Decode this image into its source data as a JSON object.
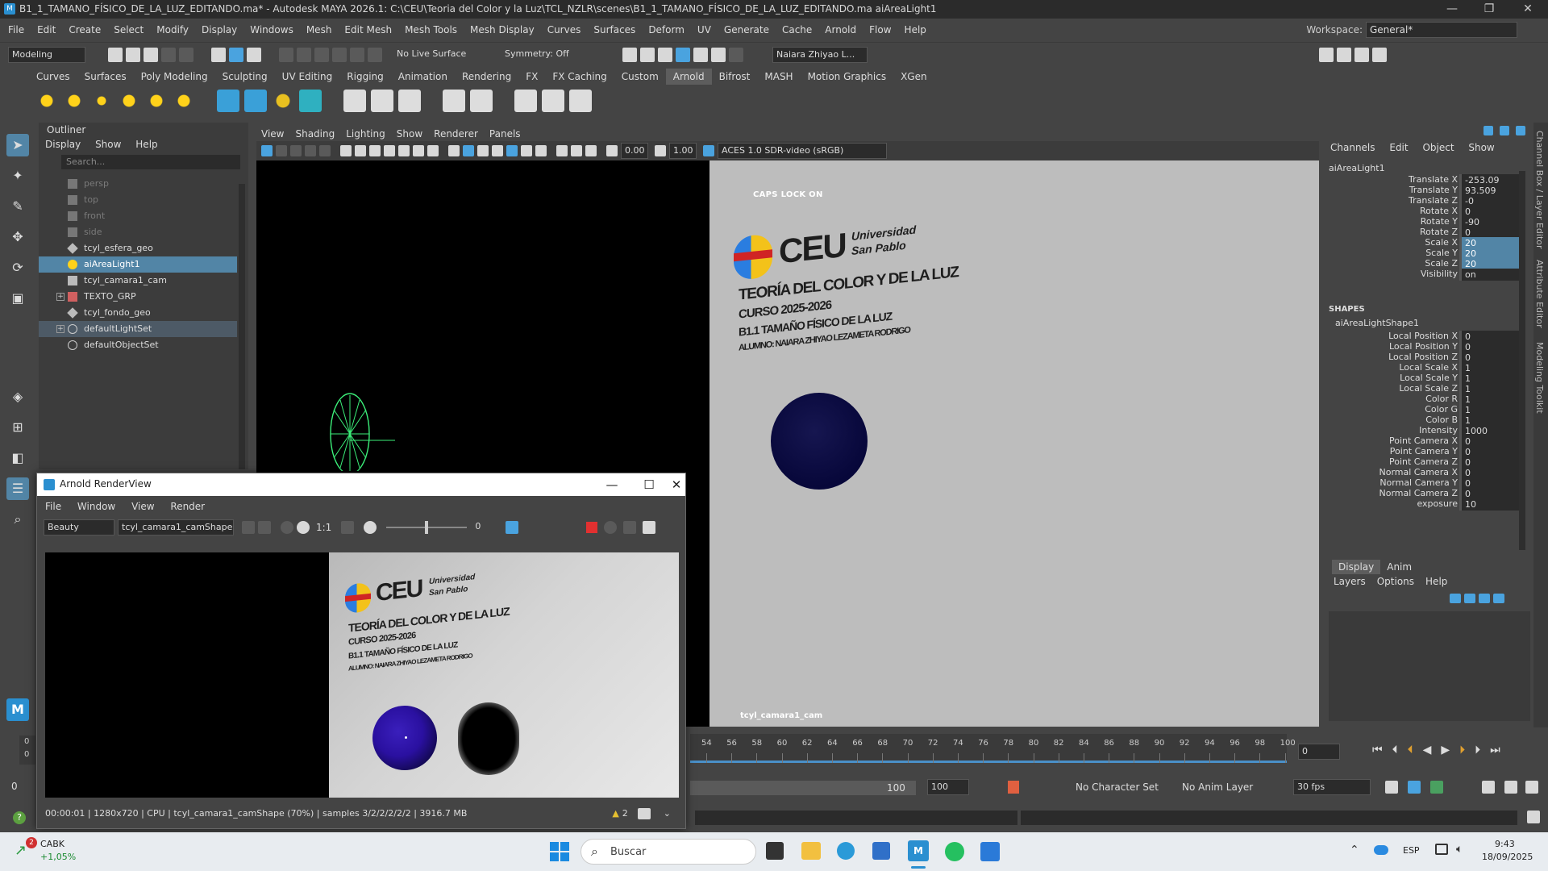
{
  "window": {
    "title": "B1_1_TAMANO_FÍSICO_DE_LA_LUZ_EDITANDO.ma* - Autodesk MAYA 2026.1: C:\\CEU\\Teoria del Color y la Luz\\TCL_NZLR\\scenes\\B1_1_TAMANO_FÍSICO_DE_LA_LUZ_EDITANDO.ma    aiAreaLight1",
    "minimize": "—",
    "maximize": "❐",
    "close": "✕"
  },
  "menubar": [
    "File",
    "Edit",
    "Create",
    "Select",
    "Modify",
    "Display",
    "Windows",
    "Mesh",
    "Edit Mesh",
    "Mesh Tools",
    "Mesh Display",
    "Curves",
    "Surfaces",
    "Deform",
    "UV",
    "Generate",
    "Cache",
    "Arnold",
    "Flow",
    "Help"
  ],
  "workspace": {
    "label": "Workspace:",
    "value": "General*"
  },
  "statusline": {
    "mode": "Modeling",
    "live_surface": "No Live Surface",
    "symmetry": "Symmetry: Off",
    "user": "Naiara Zhiyao L..."
  },
  "shelf_tabs": [
    "Curves",
    "Surfaces",
    "Poly Modeling",
    "Sculpting",
    "UV Editing",
    "Rigging",
    "Animation",
    "Rendering",
    "FX",
    "FX Caching",
    "Custom",
    "Arnold",
    "Bifrost",
    "MASH",
    "Motion Graphics",
    "XGen"
  ],
  "shelf_active": "Arnold",
  "outliner": {
    "title": "Outliner",
    "menu": [
      "Display",
      "Show",
      "Help"
    ],
    "search_placeholder": "Search...",
    "items": [
      {
        "label": "persp",
        "dim": true
      },
      {
        "label": "top",
        "dim": true
      },
      {
        "label": "front",
        "dim": true
      },
      {
        "label": "side",
        "dim": true
      },
      {
        "label": "tcyl_esfera_geo"
      },
      {
        "label": "aiAreaLight1",
        "selected": true
      },
      {
        "label": "tcyl_camara1_cam"
      },
      {
        "label": "TEXTO_GRP",
        "expandable": true
      },
      {
        "label": "tcyl_fondo_geo"
      },
      {
        "label": "defaultLightSet",
        "expandable": true,
        "highlight": true
      },
      {
        "label": "defaultObjectSet"
      }
    ]
  },
  "viewport": {
    "menu": [
      "View",
      "Shading",
      "Lighting",
      "Show",
      "Renderer",
      "Panels"
    ],
    "field_a": "0.00",
    "field_b": "1.00",
    "colorspace": "ACES 1.0 SDR-video (sRGB)",
    "caps": "CAPS LOCK ON",
    "camera": "tcyl_camara1_cam",
    "logo": {
      "ceu": "CEU",
      "univ1": "Universidad",
      "univ2": "San Pablo",
      "line1": "TEORÍA DEL COLOR Y DE LA LUZ",
      "line2": "CURSO 2025-2026",
      "line3": "B1.1 TAMAÑO FÍSICO DE LA LUZ",
      "line4": "ALUMNO: NAIARA ZHIYAO LEZAMETA RODRIGO"
    }
  },
  "channelbox": {
    "menu": [
      "Channels",
      "Edit",
      "Object",
      "Show"
    ],
    "object": "aiAreaLight1",
    "attrs": [
      {
        "k": "Translate X",
        "v": "-253.09"
      },
      {
        "k": "Translate Y",
        "v": "93.509"
      },
      {
        "k": "Translate Z",
        "v": "-0"
      },
      {
        "k": "Rotate X",
        "v": "0"
      },
      {
        "k": "Rotate Y",
        "v": "-90"
      },
      {
        "k": "Rotate Z",
        "v": "0"
      },
      {
        "k": "Scale X",
        "v": "20",
        "sel": true
      },
      {
        "k": "Scale Y",
        "v": "20",
        "sel": true
      },
      {
        "k": "Scale Z",
        "v": "20",
        "sel": true
      },
      {
        "k": "Visibility",
        "v": "on"
      }
    ],
    "shapes_label": "SHAPES",
    "shape_name": "aiAreaLightShape1",
    "shape_attrs": [
      {
        "k": "Local Position X",
        "v": "0"
      },
      {
        "k": "Local Position Y",
        "v": "0"
      },
      {
        "k": "Local Position Z",
        "v": "0"
      },
      {
        "k": "Local Scale X",
        "v": "1"
      },
      {
        "k": "Local Scale Y",
        "v": "1"
      },
      {
        "k": "Local Scale Z",
        "v": "1"
      },
      {
        "k": "Color R",
        "v": "1"
      },
      {
        "k": "Color G",
        "v": "1"
      },
      {
        "k": "Color B",
        "v": "1"
      },
      {
        "k": "Intensity",
        "v": "1000"
      },
      {
        "k": "Point Camera X",
        "v": "0"
      },
      {
        "k": "Point Camera Y",
        "v": "0"
      },
      {
        "k": "Point Camera Z",
        "v": "0"
      },
      {
        "k": "Normal Camera X",
        "v": "0"
      },
      {
        "k": "Normal Camera Y",
        "v": "0"
      },
      {
        "k": "Normal Camera Z",
        "v": "0"
      },
      {
        "k": "exposure",
        "v": "10"
      }
    ]
  },
  "layers": {
    "tabs": [
      "Display",
      "Anim"
    ],
    "menu": [
      "Layers",
      "Options",
      "Help"
    ]
  },
  "side_tabs": [
    "Channel Box / Layer Editor",
    "Attribute Editor",
    "Modeling Toolkit"
  ],
  "timeline": {
    "ticks": [
      "54",
      "56",
      "58",
      "60",
      "62",
      "64",
      "66",
      "68",
      "70",
      "72",
      "74",
      "76",
      "78",
      "80",
      "82",
      "84",
      "86",
      "88",
      "90",
      "92",
      "94",
      "96",
      "98",
      "100"
    ],
    "left_tick_a": "0",
    "left_tick_b": "0",
    "current_frame": "0",
    "range_start": "0",
    "range_end_a": "100",
    "range_end_b": "100",
    "character": "No Character Set",
    "anim_layer": "No Anim Layer",
    "fps": "30 fps"
  },
  "arv": {
    "title": "Arnold RenderView",
    "menu": [
      "File",
      "Window",
      "View",
      "Render"
    ],
    "aov": "Beauty",
    "camera": "tcyl_camara1_camShape",
    "ratio": "1:1",
    "exposure": "0",
    "status": "00:00:01 | 1280x720 | CPU | tcyl_camara1_camShape (70%) | samples 3/2/2/2/2/2 | 3916.7 MB",
    "warnings": "2"
  },
  "taskbar": {
    "stock_name": "CABK",
    "stock_change": "+1,05%",
    "search": "Buscar",
    "lang": "ESP",
    "time": "9:43",
    "date": "18/09/2025",
    "badge": "2"
  }
}
